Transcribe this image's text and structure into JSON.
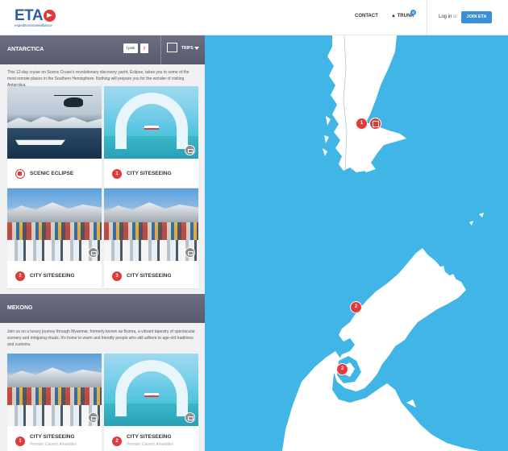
{
  "header": {
    "logo_text": "ETA",
    "logo_tagline": "expeditiontravelalliance",
    "nav_contact": "CONTACT",
    "nav_trunk": "TRUNK",
    "trunk_count": "0",
    "login": "Log in",
    "or": "or",
    "join": "JOIN ETA"
  },
  "sections": [
    {
      "title": "ANTARCTICA",
      "share_facebook": "f pink",
      "share_pinterest": "p",
      "trips_label": "TRIPS",
      "description": "This 12-day cruise on Scenic Cruise's revolutionary discovery yacht, Eclipse, takes you to some of the most remote places in the Southern Hemisphere. Nothing will prepare you for the wonder of visiting Antarctica.",
      "cards": [
        {
          "title": "SCENIC ECLIPSE",
          "pin": ""
        },
        {
          "title": "CITY SITESEEING",
          "pin": "1"
        },
        {
          "title": "CITY SITESEEING",
          "pin": "2"
        },
        {
          "title": "CITY SITESEEING",
          "pin": "3"
        }
      ]
    },
    {
      "title": "MEKONG",
      "description": "Join us on a luxury journey through Myanmar, formerly known as Burma, a vibrant tapestry of spectacular scenery and intriguing rituals. It's home to warm and friendly people who still adhere to age-old traditions and customs.",
      "cards": [
        {
          "title": "CITY SITESEEING",
          "pin": "1",
          "subtitle": "Premier Classic Amenities"
        },
        {
          "title": "CITY SITESEEING",
          "pin": "2",
          "subtitle": "Premier Classic Amenities"
        }
      ]
    }
  ],
  "map": {
    "pins": [
      {
        "label": "1"
      },
      {
        "label": ""
      },
      {
        "label": "2"
      },
      {
        "label": "3"
      }
    ],
    "colors": {
      "water": "#41b6e6",
      "land": "#ffffff",
      "pin": "#e03a3a"
    }
  }
}
